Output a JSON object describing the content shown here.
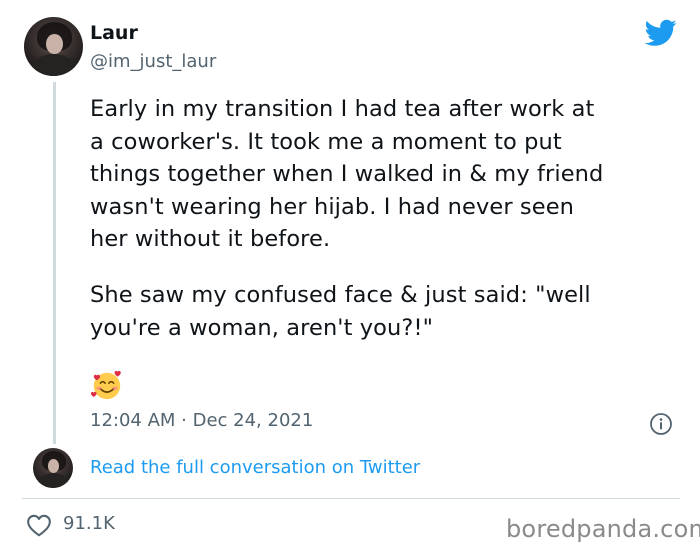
{
  "author": {
    "display_name": "Laur",
    "handle": "@im_just_laur"
  },
  "tweet": {
    "paragraph_1": "Early in my transition I had tea after work at\na coworker's. It took me a moment to put\nthings together when I walked in & my friend\nwasn't wearing her hijab. I had never seen\nher without it before.",
    "paragraph_2": "She saw my confused face & just said: \"well\nyou're a woman, aren't you?!\"",
    "emoji_icon": "smiling-face-with-hearts-icon",
    "timestamp": "12:04 AM · Dec 24, 2021"
  },
  "conversation_link": "Read the full conversation on Twitter",
  "engagement": {
    "likes": "91.1K"
  },
  "watermark": "boredpanda.com",
  "colors": {
    "twitter_blue": "#1d9bf0",
    "secondary_text": "#536471",
    "primary_text": "#0f1419"
  }
}
